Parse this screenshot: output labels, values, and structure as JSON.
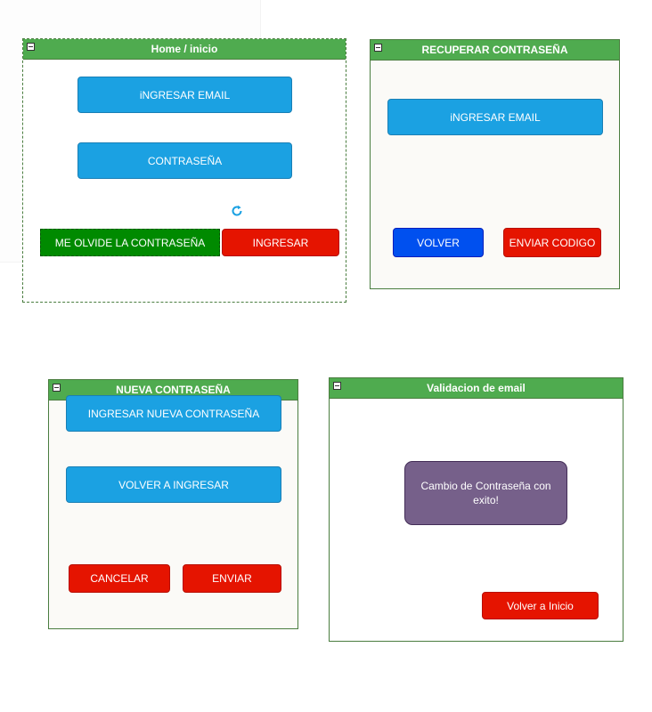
{
  "frames": {
    "home": {
      "title": "Home / inicio",
      "email_button": "iNGRESAR EMAIL",
      "password_button": "CONTRASEÑA",
      "forgot_button": "ME OLVIDE LA CONTRASEÑA",
      "login_button": "INGRESAR"
    },
    "recover": {
      "title": "RECUPERAR CONTRASEÑA",
      "email_button": "iNGRESAR EMAIL",
      "back_button": "VOLVER",
      "send_code_button": "ENVIAR CODIGO"
    },
    "new_password": {
      "title": "NUEVA CONTRASEÑA",
      "new_password_button": "INGRESAR NUEVA CONTRASEÑA",
      "repeat_button": "VOLVER A INGRESAR",
      "cancel_button": "CANCELAR",
      "send_button": "ENVIAR"
    },
    "validation": {
      "title": "Validacion de email",
      "message": "Cambio de Contraseña con exito!",
      "home_button": "Volver a Inicio"
    }
  },
  "colors": {
    "header_green": "#4fab4f",
    "blue": "#1ba1e2",
    "red": "#e51400",
    "dark_blue": "#0050ef",
    "green": "#008a00",
    "purple": "#76608a",
    "panel_bg": "#fbfaf7"
  },
  "icons": {
    "collapse": "minus-square-icon",
    "refresh": "refresh-icon"
  }
}
